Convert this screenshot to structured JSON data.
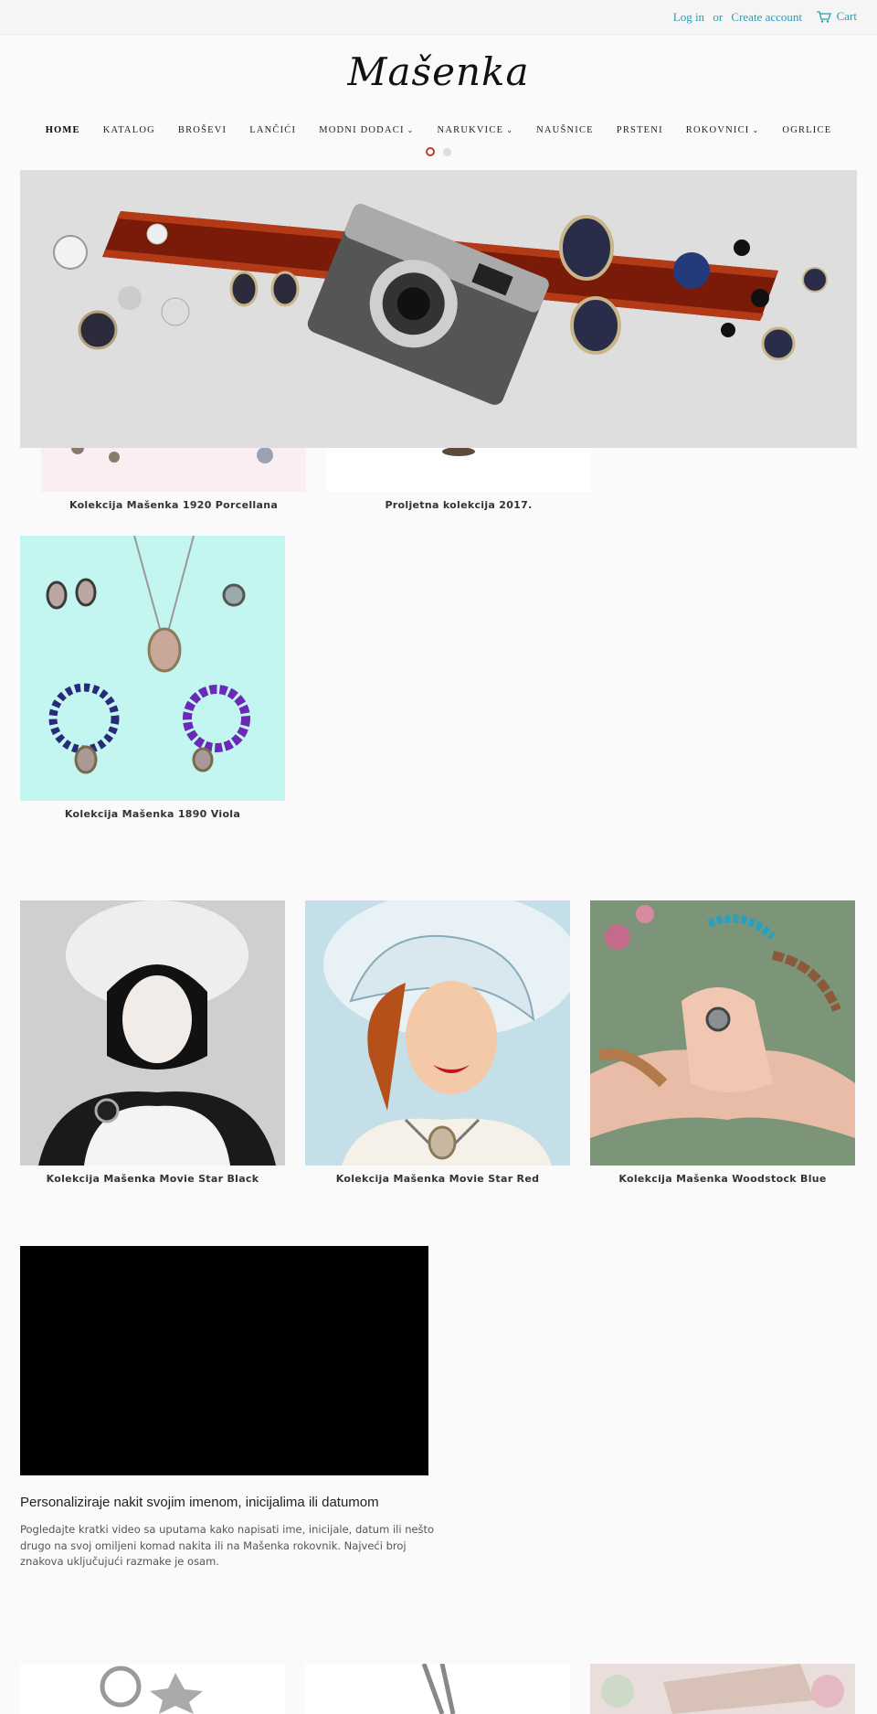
{
  "topbar": {
    "login_label": "Log in",
    "or_label": "or",
    "create_account_label": "Create account",
    "cart_label": "Cart",
    "link_color": "#2a9db3"
  },
  "logo": {
    "text": "Mašenka"
  },
  "nav": {
    "items": [
      {
        "label": "HOME",
        "active": true,
        "dropdown": false
      },
      {
        "label": "KATALOG",
        "active": false,
        "dropdown": false
      },
      {
        "label": "BROŠEVI",
        "active": false,
        "dropdown": false
      },
      {
        "label": "LANČIĆI",
        "active": false,
        "dropdown": false
      },
      {
        "label": "MODNI DODACI",
        "active": false,
        "dropdown": true
      },
      {
        "label": "NARUKVICE",
        "active": false,
        "dropdown": true
      },
      {
        "label": "NAUŠNICE",
        "active": false,
        "dropdown": false
      },
      {
        "label": "PRSTENI",
        "active": false,
        "dropdown": false
      },
      {
        "label": "ROKOVNICI",
        "active": false,
        "dropdown": true
      },
      {
        "label": "OGRLICE",
        "active": false,
        "dropdown": false
      }
    ]
  },
  "slider": {
    "slides": 2,
    "active_slide": 1,
    "accent_color": "#c0392b"
  },
  "collections_top": [
    {
      "title": "Kolekcija Mašenka 1920 Porcellana"
    },
    {
      "title": "Proljetna kolekcija 2017."
    },
    {
      "title": "Kolekcija Mašenka 1890 Viola"
    }
  ],
  "collections_middle": [
    {
      "title": "Kolekcija Mašenka Movie Star Black"
    },
    {
      "title": "Kolekcija Mašenka Movie Star Red"
    },
    {
      "title": "Kolekcija Mašenka Woodstock Blue"
    }
  ],
  "video_section": {
    "heading": "Personaliziraje nakit svojim imenom, inicijalima ili datumom",
    "text": "Pogledajte kratki video sa uputama kako napisati ime, inicijale, datum ili nešto drugo na svoj omiljeni komad nakita ili na Mašenka rokovnik. Najveći broj znakova uključujući razmake je osam."
  }
}
